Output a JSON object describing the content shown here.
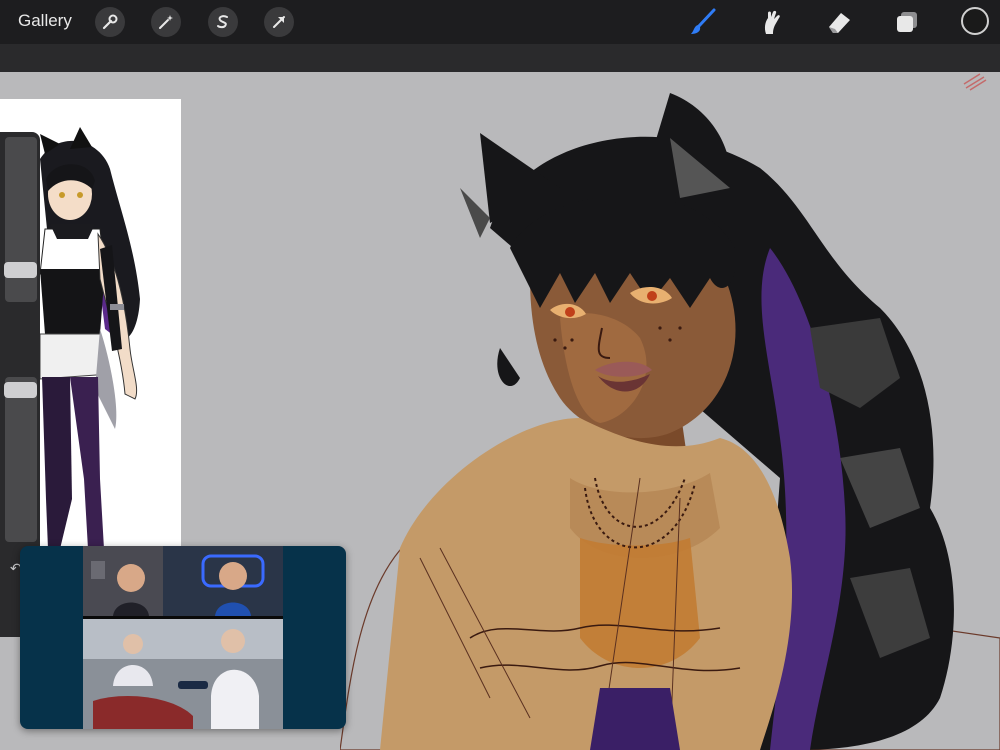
{
  "toolbar": {
    "gallery_label": "Gallery",
    "left_tools": [
      "wrench-icon",
      "magic-wand-icon",
      "selection-icon",
      "transform-arrow-icon"
    ],
    "right_tools": [
      "brush-icon",
      "smudge-icon",
      "eraser-icon",
      "layers-icon"
    ],
    "active_tool": "brush-icon",
    "accent_color": "#2f7cf6",
    "current_color": "#1a1a1a"
  },
  "sidebar": {
    "brush_size_level": 0.28,
    "opacity_level": 0.92
  },
  "colors": {
    "canvas_bg": "#b9b9bb",
    "toolbar_bg": "#1d1d1f",
    "pip_bg": "#06324a"
  }
}
